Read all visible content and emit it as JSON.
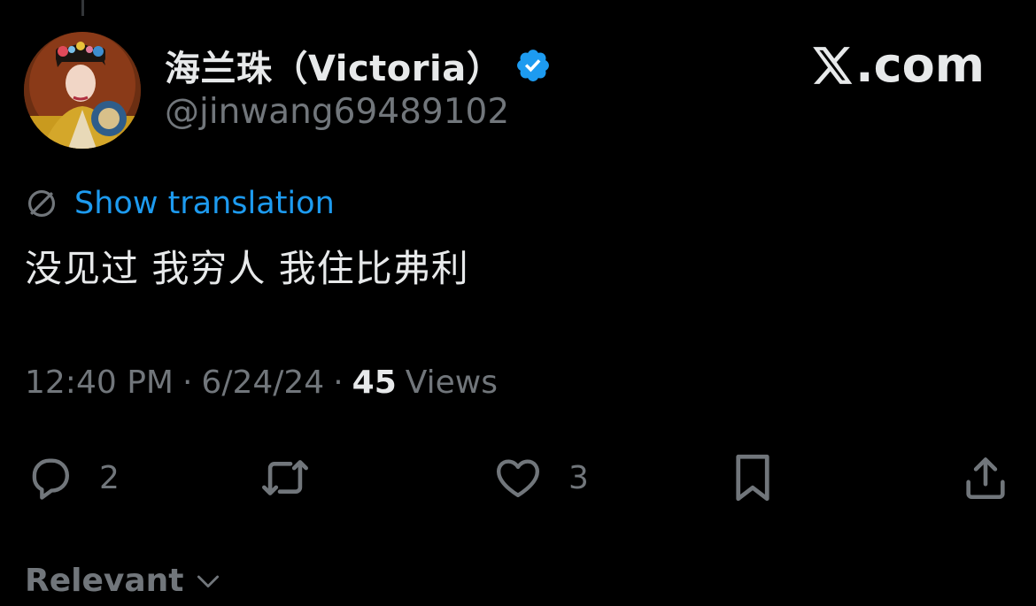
{
  "author": {
    "display_name": "海兰珠（Victoria）",
    "handle": "@jinwang69489102",
    "verified": true,
    "verified_color": "#1d9bf0"
  },
  "brand": {
    "label": ".com",
    "x_icon": "x-logo-icon"
  },
  "translation": {
    "icon": "globe-icon",
    "label": "Show translation",
    "color": "#1d9bf0"
  },
  "tweet": {
    "text": "没见过 我穷人 我住比弗利"
  },
  "meta": {
    "time": "12:40 PM",
    "separator": "·",
    "date": "6/24/24",
    "views_count": "45",
    "views_label": "Views"
  },
  "actions": {
    "reply": {
      "icon": "reply-icon",
      "count": "2"
    },
    "repost": {
      "icon": "repost-icon",
      "count": ""
    },
    "like": {
      "icon": "heart-icon",
      "count": "3"
    },
    "bookmark": {
      "icon": "bookmark-icon"
    },
    "share": {
      "icon": "share-icon"
    }
  },
  "replies_sort": {
    "label": "Relevant",
    "icon": "chevron-down-icon"
  }
}
